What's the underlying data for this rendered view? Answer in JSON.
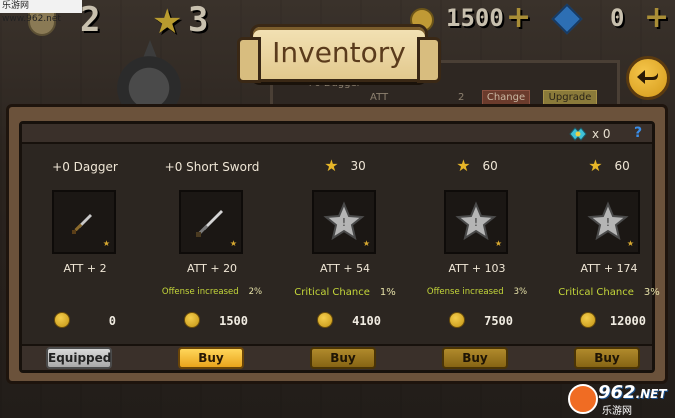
{
  "watermark_top": "乐游网 www.962.net",
  "hud": {
    "level": "2",
    "stars": "3",
    "coins": "1500",
    "coins_plus": "+",
    "gems": "0",
    "gems_plus": "+"
  },
  "background": {
    "item_name": "+0 Dagger",
    "att_label": "ATT",
    "count": "2",
    "change_label": "Change",
    "upgrade_label": "Upgrade"
  },
  "title": "Inventory",
  "header": {
    "ticket_count": "x 0",
    "help": "?"
  },
  "items": [
    {
      "name": "+0 Dagger",
      "stars": null,
      "att": "ATT + 2",
      "effect": "",
      "effect_pct": "",
      "price": "0",
      "button": "Equipped",
      "button_style": "equipped",
      "icon": "dagger-icon"
    },
    {
      "name": "+0 Short Sword",
      "stars": null,
      "att": "ATT + 20",
      "effect": "Offense increased",
      "effect_pct": "2%",
      "price": "1500",
      "button": "Buy",
      "button_style": "active",
      "icon": "short-sword-icon"
    },
    {
      "name": "",
      "stars": "30",
      "att": "ATT + 54",
      "effect": "Critical Chance",
      "effect_pct": "1%",
      "price": "4100",
      "button": "Buy",
      "button_style": "normal",
      "icon": "locked-star-icon"
    },
    {
      "name": "",
      "stars": "60",
      "att": "ATT + 103",
      "effect": "Offense increased",
      "effect_pct": "3%",
      "price": "7500",
      "button": "Buy",
      "button_style": "normal",
      "icon": "locked-star-icon"
    },
    {
      "name": "",
      "stars": "60",
      "att": "ATT + 174",
      "effect": "Critical Chance",
      "effect_pct": "3%",
      "price": "12000",
      "button": "Buy",
      "button_style": "normal",
      "icon": "locked-star-icon"
    }
  ],
  "watermark_logo": {
    "number": "962",
    "suffix": ".NET",
    "site": "乐游网"
  },
  "colors": {
    "gold": "#e7b628",
    "effect_green": "#c4d63a",
    "help_blue": "#3b8ee8"
  }
}
